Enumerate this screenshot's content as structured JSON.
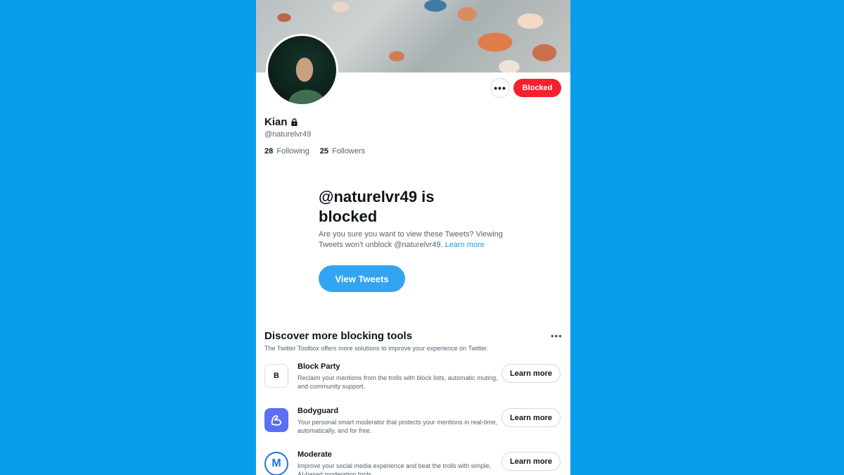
{
  "profile": {
    "name": "Kian",
    "handle": "@naturelvr49",
    "following_count": "28",
    "following_label": "Following",
    "followers_count": "25",
    "followers_label": "Followers",
    "more_label": "•••",
    "blocked_label": "Blocked"
  },
  "blocked_notice": {
    "title": "@naturelvr49 is blocked",
    "description": "Are you sure you want to view these Tweets? Viewing Tweets won't unblock @naturelvr49.",
    "learn_more": "Learn more",
    "button": "View Tweets"
  },
  "discover": {
    "title": "Discover more blocking tools",
    "subtitle": "The Twitter Toolbox offers more solutions to improve your experience on Twitter.",
    "more_label": "•••",
    "tools": [
      {
        "name": "Block Party",
        "description": "Reclaim your mentions from the trolls with block lists, automatic muting, and community support.",
        "button": "Learn more",
        "icon": "block-party-logo",
        "icon_letter": "B"
      },
      {
        "name": "Bodyguard",
        "description": "Your personal smart moderator that protects your mentions in real-time, automatically, and for free.",
        "button": "Learn more",
        "icon": "bodyguard-logo"
      },
      {
        "name": "Moderate",
        "description": "Improve your social media experience and beat the trolls with simple, AI-based moderation tools.",
        "button": "Learn more",
        "icon": "moderate-logo",
        "icon_letter": "M"
      }
    ]
  },
  "colors": {
    "background": "#0a9eea",
    "blocked_red": "#f4212e",
    "twitter_blue": "#1d9bf0"
  }
}
